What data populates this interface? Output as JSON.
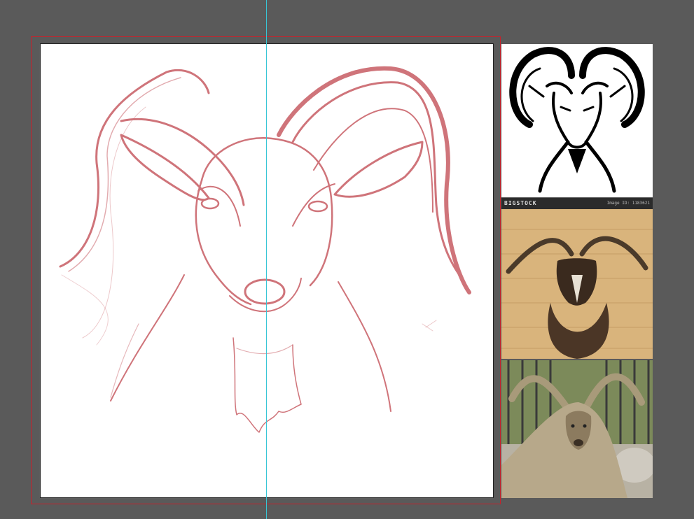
{
  "canvas": {
    "artboard_label": "",
    "sketch_color": "#c0464e",
    "guide_color": "#38c6d6",
    "bleed_color": "#c8212b"
  },
  "references": {
    "items": [
      {
        "kind": "ram-head-line-art",
        "icon": "ram-head-icon"
      },
      {
        "kind": "mounted-ibex-trophy",
        "icon": "ibex-mount-photo",
        "watermark": "BIGSTOCK",
        "watermark_id": "Image ID: 1183621"
      },
      {
        "kind": "ibex-resting-photo",
        "icon": "ibex-photo"
      }
    ]
  }
}
